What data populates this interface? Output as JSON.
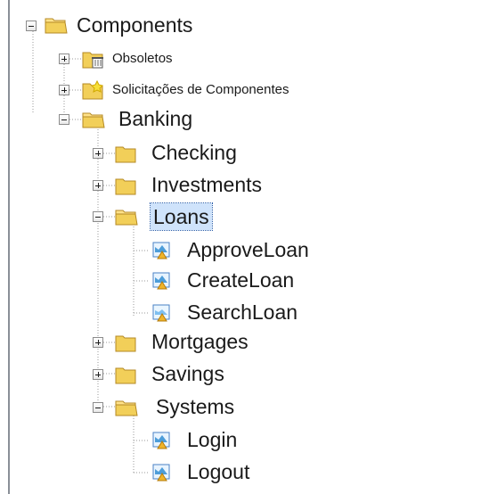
{
  "tree": {
    "nodes": [
      {
        "label": "Components",
        "icon": "open-folder-icon",
        "state": "expanded"
      },
      {
        "label": "Obsoletos",
        "icon": "obsolete-folder-icon",
        "state": "collapsed"
      },
      {
        "label": "Solicitações de Componentes",
        "icon": "request-folder-icon",
        "state": "collapsed"
      },
      {
        "label": "Banking",
        "icon": "open-folder-icon",
        "state": "expanded"
      },
      {
        "label": "Checking",
        "icon": "folder-icon",
        "state": "collapsed"
      },
      {
        "label": "Investments",
        "icon": "folder-icon",
        "state": "collapsed"
      },
      {
        "label": "Loans",
        "icon": "open-folder-icon",
        "state": "expanded",
        "selected": true
      },
      {
        "label": "ApproveLoan",
        "icon": "component-icon"
      },
      {
        "label": "CreateLoan",
        "icon": "component-icon"
      },
      {
        "label": "SearchLoan",
        "icon": "component-icon"
      },
      {
        "label": "Mortgages",
        "icon": "folder-icon",
        "state": "collapsed"
      },
      {
        "label": "Savings",
        "icon": "folder-icon",
        "state": "collapsed"
      },
      {
        "label": "Systems",
        "icon": "open-folder-icon",
        "state": "expanded"
      },
      {
        "label": "Login",
        "icon": "component-icon"
      },
      {
        "label": "Logout",
        "icon": "component-icon"
      }
    ]
  },
  "colors": {
    "folder": "#f2cf59",
    "folder_dark": "#d2a62c",
    "selection": "#cfe3fb",
    "tree_line": "#9a9a9a"
  }
}
